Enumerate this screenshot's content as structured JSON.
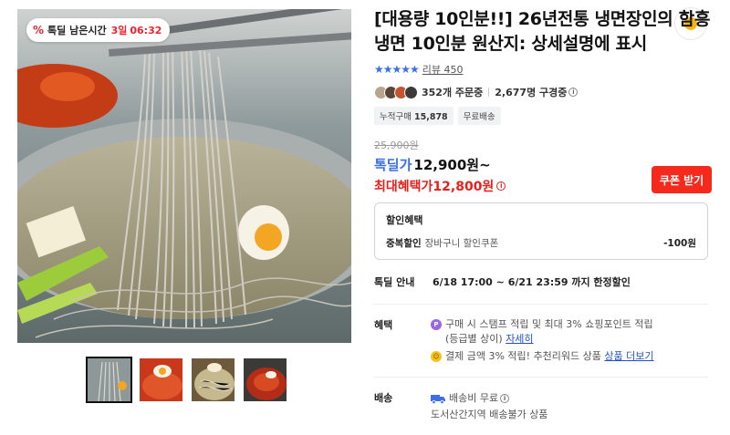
{
  "timer": {
    "icon": "percent-icon",
    "label": "톡딜 남은시간",
    "days": "3일",
    "time": "06:32"
  },
  "product": {
    "title": "[대용량 10인분!!] 26년전통 냉면장인의 함흥냉면 10인분 원산지: 상세설명에 표시",
    "stars": "★★★★★",
    "review_label": "리뷰 450",
    "orders": "352개 주문중",
    "viewers": "2,677명 구경중",
    "chips": {
      "cumulative_label": "누적구매",
      "cumulative_value": "15,878",
      "shipping": "무료배송"
    }
  },
  "price": {
    "original": "25,900원",
    "deal_label": "톡딜가",
    "deal_value": "12,900원~",
    "max_label": "최대혜택가",
    "max_value": "12,800원",
    "coupon_button": "쿠폰 받기"
  },
  "discount": {
    "title": "할인혜택",
    "row_label": "중복할인",
    "row_desc": "장바구니 할인쿠폰",
    "row_amount": "-100원"
  },
  "deal": {
    "label": "톡딜 안내",
    "period": "6/18 17:00 ~ 6/21 23:59 까지 한정할인"
  },
  "benefit": {
    "label": "혜택",
    "line1": "구매 시 스탬프 적립 및 최대 3% 쇼핑포인트 적립",
    "line1b": "(등급별 상이)",
    "line1_link": "자세히",
    "line2": "결제 금액 3% 적립! 추천리워드 상품",
    "line2_link": "상품 더보기"
  },
  "shipping": {
    "label": "배송",
    "fee": "배송비 무료",
    "note": "도서산간지역 배송불가 상품"
  },
  "colors": {
    "accent_blue": "#3b6ee9",
    "sale_red": "#e8201b",
    "coupon_red": "#f5291c"
  }
}
